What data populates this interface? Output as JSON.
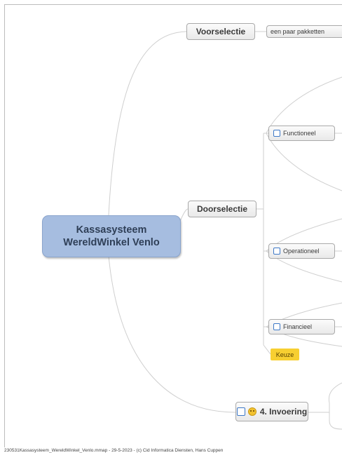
{
  "central": {
    "line1": "Kassasysteem",
    "line2": "WereldWinkel Venlo"
  },
  "topics": {
    "voorselectie": "Voorselectie",
    "voorselectie_child": "een paar pakketten",
    "doorselectie": "Doorselectie",
    "functioneel": "Functioneel",
    "operationeel": "Operationeel",
    "financieel": "Financieel",
    "keuze": "Keuze",
    "invoering": "4. Invoering"
  },
  "icons": {
    "checkbox": "checkbox-icon",
    "smiley": "smiley-icon"
  },
  "colors": {
    "central_fill": "#a6bde0",
    "keuze_fill": "#f7cf31",
    "checkbox_border": "#3d78c7",
    "connector": "#cfcfcf"
  },
  "footer": "230531Kassasysteem_WereldWinkel_Venlo.mmap - 29-5-2023 - (c) Cid Informatica Diensten, Hans Cuppen"
}
